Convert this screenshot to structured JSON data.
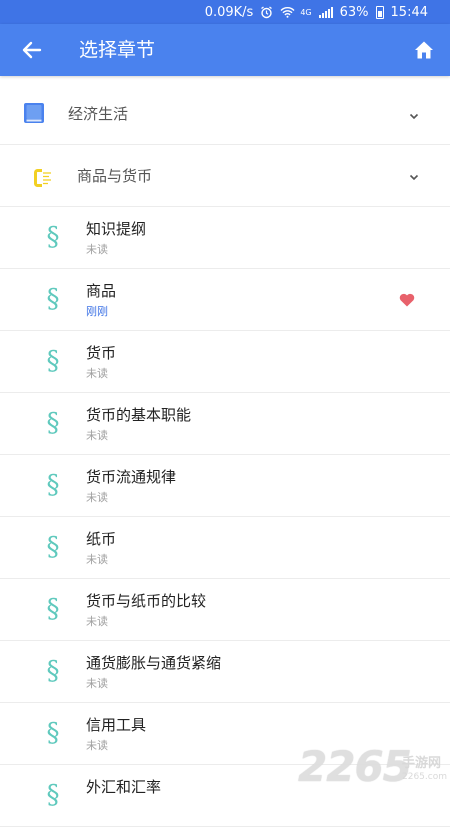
{
  "status_bar": {
    "speed": "0.09K/s",
    "network": "4G",
    "battery": "63%",
    "time": "15:44"
  },
  "app_bar": {
    "title": "选择章节"
  },
  "unit": {
    "label": "经济生活",
    "icon": "book-icon"
  },
  "chapter": {
    "label": "商品与货币",
    "icon": "coin-icon"
  },
  "sections": [
    {
      "title": "知识提纲",
      "status": "未读"
    },
    {
      "title": "商品",
      "status": "刚刚",
      "favorite": true
    },
    {
      "title": "货币",
      "status": "未读"
    },
    {
      "title": "货币的基本职能",
      "status": "未读"
    },
    {
      "title": "货币流通规律",
      "status": "未读"
    },
    {
      "title": "纸币",
      "status": "未读"
    },
    {
      "title": "货币与纸币的比较",
      "status": "未读"
    },
    {
      "title": "通货膨胀与通货紧缩",
      "status": "未读"
    },
    {
      "title": "信用工具",
      "status": "未读"
    },
    {
      "title": "外汇和汇率",
      "status": ""
    }
  ],
  "colors": {
    "app_bar": "#4a82ee",
    "status_bar": "#3f74e6",
    "section_icon": "#5fc9bd",
    "recent": "#3f74e6",
    "heart": "#e8616b"
  },
  "watermark": {
    "number": "2265",
    "text": "手游网",
    "url": "2265.com"
  }
}
